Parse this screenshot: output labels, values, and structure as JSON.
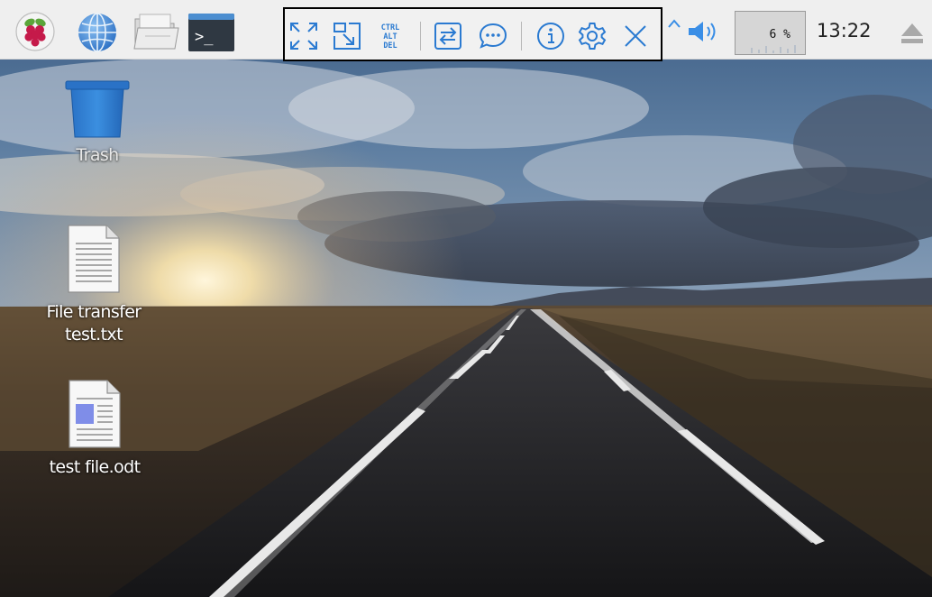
{
  "panel": {
    "launchers": [
      {
        "name": "raspberry-menu-icon"
      },
      {
        "name": "web-browser-icon"
      },
      {
        "name": "file-manager-icon"
      },
      {
        "name": "terminal-icon"
      }
    ],
    "cpu_usage": "6 %",
    "clock": "13:22"
  },
  "vnc_toolbar": {
    "buttons": [
      "fullscreen-icon",
      "scale-icon",
      "ctrl-alt-del-icon",
      "file-transfer-icon",
      "chat-icon",
      "info-icon",
      "settings-icon",
      "close-icon"
    ],
    "ctrl_alt_del": [
      "CTRL",
      "ALT",
      "DEL"
    ]
  },
  "desktop": {
    "icons": [
      {
        "label": "Trash",
        "icon": "trash-icon"
      },
      {
        "label": "File transfer\ntest.txt",
        "label_line1": "File transfer",
        "label_line2": "test.txt",
        "icon": "text-file-icon"
      },
      {
        "label": "test file.odt",
        "icon": "document-icon"
      }
    ]
  },
  "colors": {
    "panel_bg": "#efefef",
    "accent_blue": "#2a7ad1",
    "volume_blue": "#3a8ee6"
  }
}
